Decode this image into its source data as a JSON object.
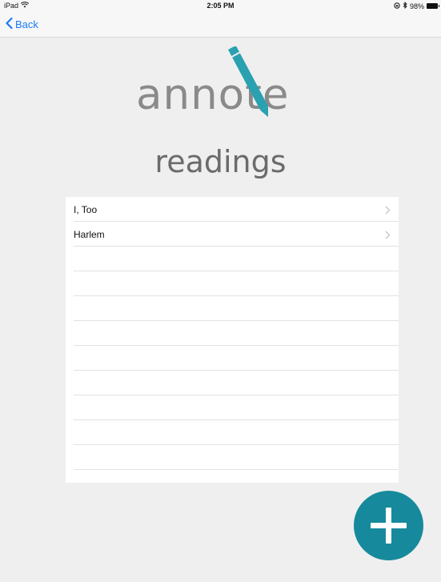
{
  "status_bar": {
    "device": "iPad",
    "time": "2:05 PM",
    "battery": "98%"
  },
  "nav": {
    "back_label": "Back"
  },
  "logo": {
    "text": "annote",
    "brand_color": "#2aa1b0"
  },
  "page_title": "readings",
  "readings": [
    {
      "title": "I, Too"
    },
    {
      "title": "Harlem"
    }
  ],
  "accent_color": "#168a9c",
  "icons": {
    "back": "chevron-left-icon",
    "row_disclosure": "chevron-right-icon",
    "add": "plus-icon"
  }
}
